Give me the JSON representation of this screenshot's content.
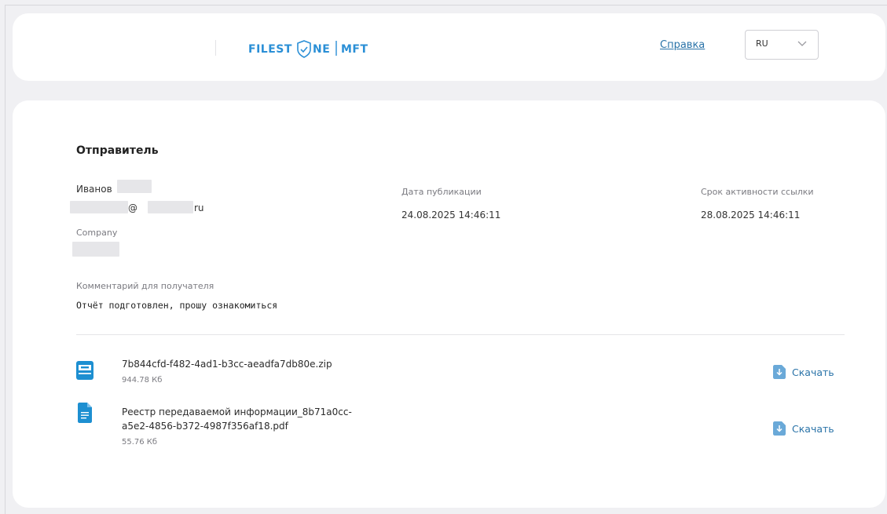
{
  "header": {
    "logo_text_left": "FILESTONE",
    "logo_text_right": "MFT",
    "help_label": "Справка",
    "language": "RU"
  },
  "sender": {
    "section_title": "Отправитель",
    "name": "Иванов",
    "email_at": "@",
    "email_tail": "ru",
    "company_label": "Company"
  },
  "publication": {
    "label": "Дата публикации",
    "value": "24.08.2025 14:46:11"
  },
  "expiry": {
    "label": "Срок активности ссылки",
    "value": "28.08.2025 14:46:11"
  },
  "comment": {
    "label": "Комментарий для получателя",
    "text": "Отчёт подготовлен, прошу ознакомиться"
  },
  "files": [
    {
      "name_line1": "7b844cfd-f482-4ad1-b3cc-aeadfa7db80e.zip",
      "size": "944.78 Кб",
      "icon": "archive-icon",
      "download_label": "Скачать"
    },
    {
      "name_line1": "Реестр передаваемой информации_8b71a0cc-",
      "name_line2": "a5e2-4856-b372-4987f356af18.pdf",
      "size": "55.76 Кб",
      "icon": "document-icon",
      "download_label": "Скачать"
    }
  ],
  "colors": {
    "accent": "#2a73a8",
    "icon_blue": "#1d8fd1",
    "logo_blue": "#2a8fd6"
  }
}
